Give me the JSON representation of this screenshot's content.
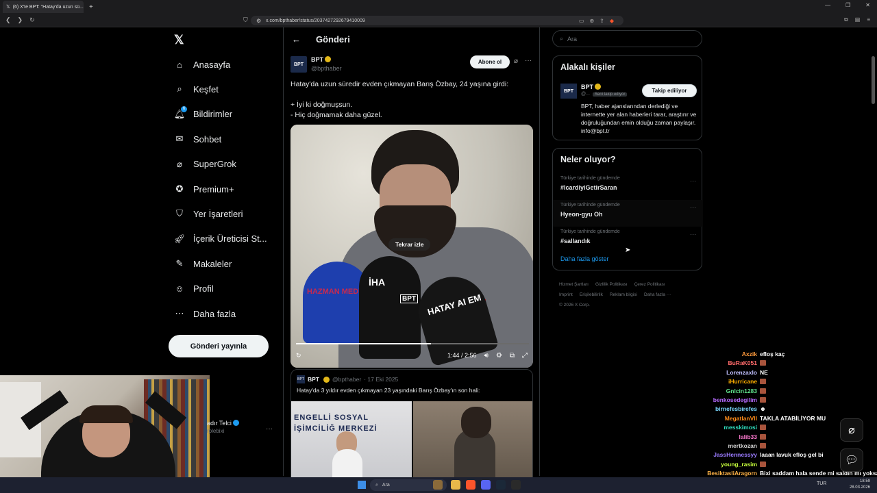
{
  "browser": {
    "tab_title": "(6) X'te BPT: \"Hatay'da uzun sü...",
    "url": "x.com/bpthaber/status/2037427292679410009",
    "new_tab": "+"
  },
  "nav": {
    "items": [
      {
        "label": "Anasayfa",
        "icon": "home-icon"
      },
      {
        "label": "Keşfet",
        "icon": "search-icon"
      },
      {
        "label": "Bildirimler",
        "icon": "bell-icon",
        "badge": "6"
      },
      {
        "label": "Sohbet",
        "icon": "mail-icon"
      },
      {
        "label": "SuperGrok",
        "icon": "grok-icon"
      },
      {
        "label": "Premium+",
        "icon": "premium-icon"
      },
      {
        "label": "Yer İşaretleri",
        "icon": "bookmark-icon"
      },
      {
        "label": "İçerik Üreticisi St...",
        "icon": "rocket-icon"
      },
      {
        "label": "Makaleler",
        "icon": "article-icon"
      },
      {
        "label": "Profil",
        "icon": "profile-icon"
      },
      {
        "label": "Daha fazla",
        "icon": "more-circle-icon"
      }
    ],
    "post_button": "Gönderi yayınla",
    "account_name": "adır Telci",
    "account_handle": "rplebixi"
  },
  "main": {
    "title": "Gönderi",
    "author_name": "BPT",
    "author_handle": "@bpthaber",
    "avatar_text": "BPT",
    "subscribe": "Abone ol",
    "tweet_line1": "Hatay'da uzun süredir evden çıkmayan Barış Özbay, 24 yaşına girdi:",
    "tweet_line2": "+ İyi ki doğmuşsun.",
    "tweet_line3": "- Hiç doğmamak daha güzel.",
    "video": {
      "replay": "Tekrar izle",
      "time": "1:44 / 2:56",
      "progress": 0.58,
      "watermark": "BPT",
      "mic1": "HAZMAN MEDYA",
      "mic2": "İHA",
      "mic3": "HATAY AI EM"
    },
    "quote": {
      "name": "BPT",
      "handle": "@bpthaber",
      "date": "· 17 Eki 2025",
      "text": "Hatay'da 3 yıldır evden çıkmayan 23 yaşındaki Barış Özbay'ın son hali:",
      "sign": "ENGELLİ SOSYAL\nİŞİMCİLİĞ MERKEZİ"
    }
  },
  "right": {
    "search_placeholder": "Ara",
    "related_title": "Alakalı kişiler",
    "related_name": "BPT",
    "related_handle": "@...",
    "follows_you": "Seni takip ediyor",
    "following": "Takip ediliyor",
    "bio": "BPT, haber ajanslarından derlediği ve internette yer alan haberleri tarar, araştırır ve doğruluğundan emin olduğu zaman paylaşır. info@bpt.tr",
    "trends_title": "Neler oluyor?",
    "trends": [
      {
        "category": "Türkiye tarihinde gündemde",
        "name": "#IcardiyiGetirSaran"
      },
      {
        "category": "Türkiye tarihinde gündemde",
        "name": "Hyeon-gyu Oh"
      },
      {
        "category": "Türkiye tarihinde gündemde",
        "name": "#sallandık"
      }
    ],
    "show_more": "Daha fazla göster",
    "footer": [
      "Hizmet Şartları",
      "Gizlilik Politikası",
      "Çerez Politikası",
      "Imprint",
      "Erişilebilirlik",
      "Reklam bilgisi",
      "Daha fazla ···",
      "© 2026 X Corp."
    ]
  },
  "chat": [
    {
      "user": "Axzik",
      "color": "#ff9a3c",
      "msg": "efloş kaç"
    },
    {
      "user": "BuRaK051",
      "color": "#ff6b6b",
      "msg": ""
    },
    {
      "user": "Lorenzaxlo",
      "color": "#c0c0ff",
      "msg": "NE"
    },
    {
      "user": "iHurricane",
      "color": "#ffb000",
      "msg": ""
    },
    {
      "user": "Gnlcin1283",
      "color": "#5fe08a",
      "msg": ""
    },
    {
      "user": "benkosedegilim",
      "color": "#b76bff",
      "msg": ""
    },
    {
      "user": "birnefesbirefes",
      "color": "#7ad8ff",
      "msg": "☻"
    },
    {
      "user": "MegatlanVII",
      "color": "#ff8c1a",
      "msg": "TAKLA ATABİLİYOR MU"
    },
    {
      "user": "messkimosi",
      "color": "#2fe0c0",
      "msg": ""
    },
    {
      "user": "lalib33",
      "color": "#ff7ad0",
      "msg": ""
    },
    {
      "user": "mertkozan",
      "color": "#d0d0d0",
      "msg": ""
    },
    {
      "user": "JassHennessyy",
      "color": "#9b7bff",
      "msg": "laaan lavuk efloş gel bi"
    },
    {
      "user": "young_rasim",
      "color": "#c8ff3c",
      "msg": ""
    },
    {
      "user": "BesiktasliAragorn",
      "color": "#ffb347",
      "msg": "Bixi saddam hala sende mi saldın mı yoksa"
    }
  ],
  "taskbar": {
    "search": "Ara",
    "lang": "TUR",
    "time": "18:59",
    "date": "28.03.2026"
  }
}
